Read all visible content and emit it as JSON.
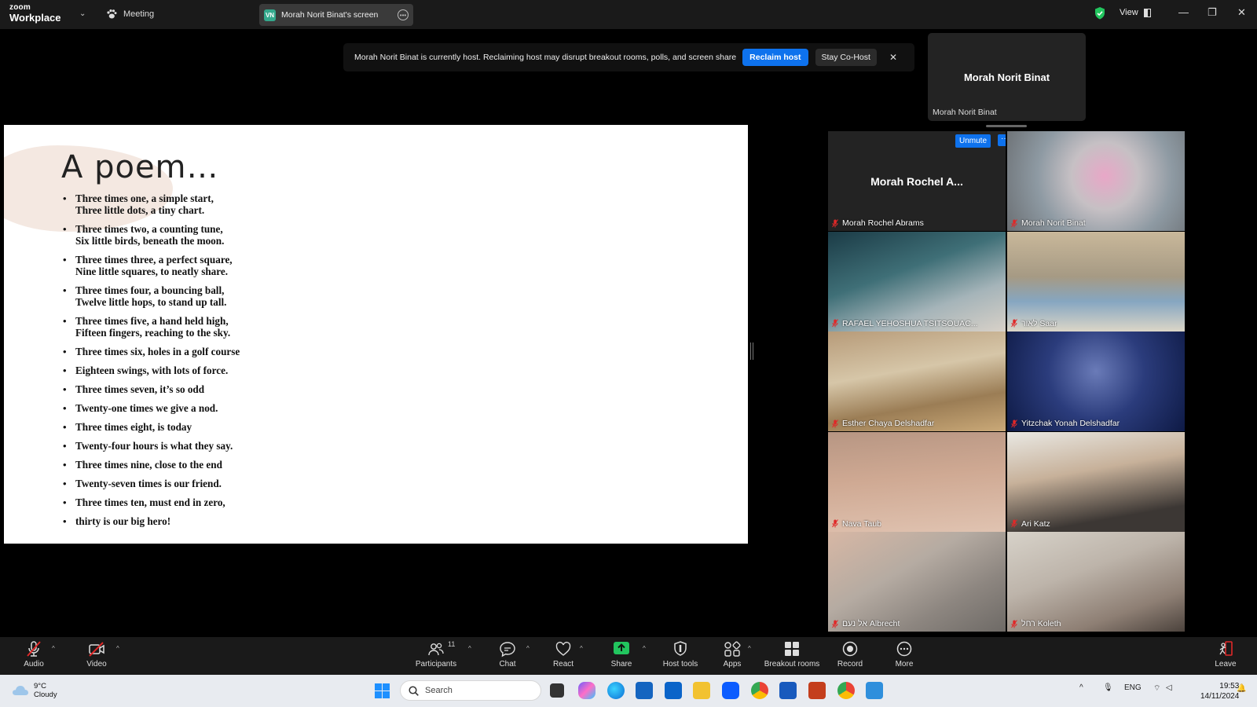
{
  "titlebar": {
    "brand_top": "zoom",
    "brand_bottom": "Workplace",
    "meeting_label": "Meeting",
    "screen_initials": "VN",
    "screen_label": "Morah Norit Binat's screen",
    "view_label": "View",
    "shield_color": "#22c55e"
  },
  "notice": {
    "text": "Morah Norit Binat is currently host. Reclaiming host may disrupt breakout rooms, polls, and screen share",
    "reclaim": "Reclaim host",
    "stay": "Stay Co-Host"
  },
  "host_tile": {
    "big_name": "Morah Norit Binat",
    "label": "Morah Norit Binat"
  },
  "slide": {
    "title": "A poem…",
    "lines": [
      [
        "Three times one, a simple start,",
        "Three little dots, a tiny chart."
      ],
      [
        "Three times two, a counting tune,",
        "Six little birds, beneath the moon."
      ],
      [
        "Three times three, a perfect square,",
        "Nine little squares, to neatly share."
      ],
      [
        "Three times four, a bouncing ball,",
        "Twelve little hops, to stand up tall."
      ],
      [
        "Three times five, a hand held high,",
        "Fifteen fingers, reaching to the sky."
      ],
      [
        "Three times six, holes in a golf course"
      ],
      [
        "Eighteen swings, with lots of force."
      ],
      [
        "Three times seven, it’s so odd"
      ],
      [
        "Twenty-one times we give a nod."
      ],
      [
        "Three times eight, is today"
      ],
      [
        "Twenty-four hours is what they say."
      ],
      [
        "Three times nine, close to the end"
      ],
      [
        "Twenty-seven times is our friend."
      ],
      [
        "Three times ten, must end in zero,"
      ],
      [
        "thirty is our big hero!"
      ]
    ]
  },
  "gallery": {
    "first_tile_big": "Morah Rochel A...",
    "unmute": "Unmute",
    "more": "···",
    "participants": [
      "Morah Rochel Abrams",
      "Morah Norit Binat",
      "RAFAEL YEHOSHUA TSITSOUAC...",
      "לאור Saar",
      "Esther Chaya Delshadfar",
      "Yitzchak Yonah Delshadfar",
      "Nava  Taub",
      "Ari Katz",
      "אל נעם Albrecht",
      "רחל Koleth"
    ]
  },
  "toolbar": {
    "audio": "Audio",
    "video": "Video",
    "participants": "Participants",
    "participants_count": "11",
    "chat": "Chat",
    "react": "React",
    "share": "Share",
    "host_tools": "Host tools",
    "apps": "Apps",
    "breakout": "Breakout rooms",
    "record": "Record",
    "more": "More",
    "leave": "Leave",
    "share_color": "#22c55e"
  },
  "taskbar": {
    "temp": "9°C",
    "condition": "Cloudy",
    "search": "Search",
    "lang": "ENG",
    "time": "19:53",
    "date": "14/11/2024"
  }
}
